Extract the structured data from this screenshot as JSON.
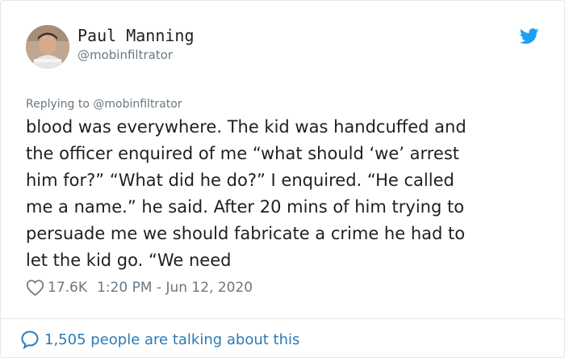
{
  "author": {
    "display_name": "Paul Manning",
    "handle": "@mobinfiltrator",
    "avatar_icon": "user-photo-avatar"
  },
  "reply_context": "Replying to @mobinfiltrator",
  "tweet": {
    "lines": [
      "blood was everywhere. The kid was handcuffed and",
      "the officer enquired of me “what should ‘we’ arrest",
      "him for?” “What did he do?” I enquired. “He called",
      "me a name.” he said. After 20 mins of him trying to",
      "persuade me we should fabricate a crime he had to",
      "let the kid go. “We need"
    ]
  },
  "meta": {
    "likes": "17.6K",
    "timestamp": "1:20 PM - Jun 12, 2020"
  },
  "footer": {
    "talking_label": "1,505 people are talking about this"
  },
  "colors": {
    "twitter_blue": "#1da1f2",
    "link_blue": "#2b7bb9",
    "muted_gray": "#697882",
    "text_dark": "#1c2022",
    "border": "#e1e8ed"
  },
  "icons": {
    "brand": "twitter-bird-icon",
    "like": "heart-outline-icon",
    "conversation": "speech-bubble-icon"
  }
}
